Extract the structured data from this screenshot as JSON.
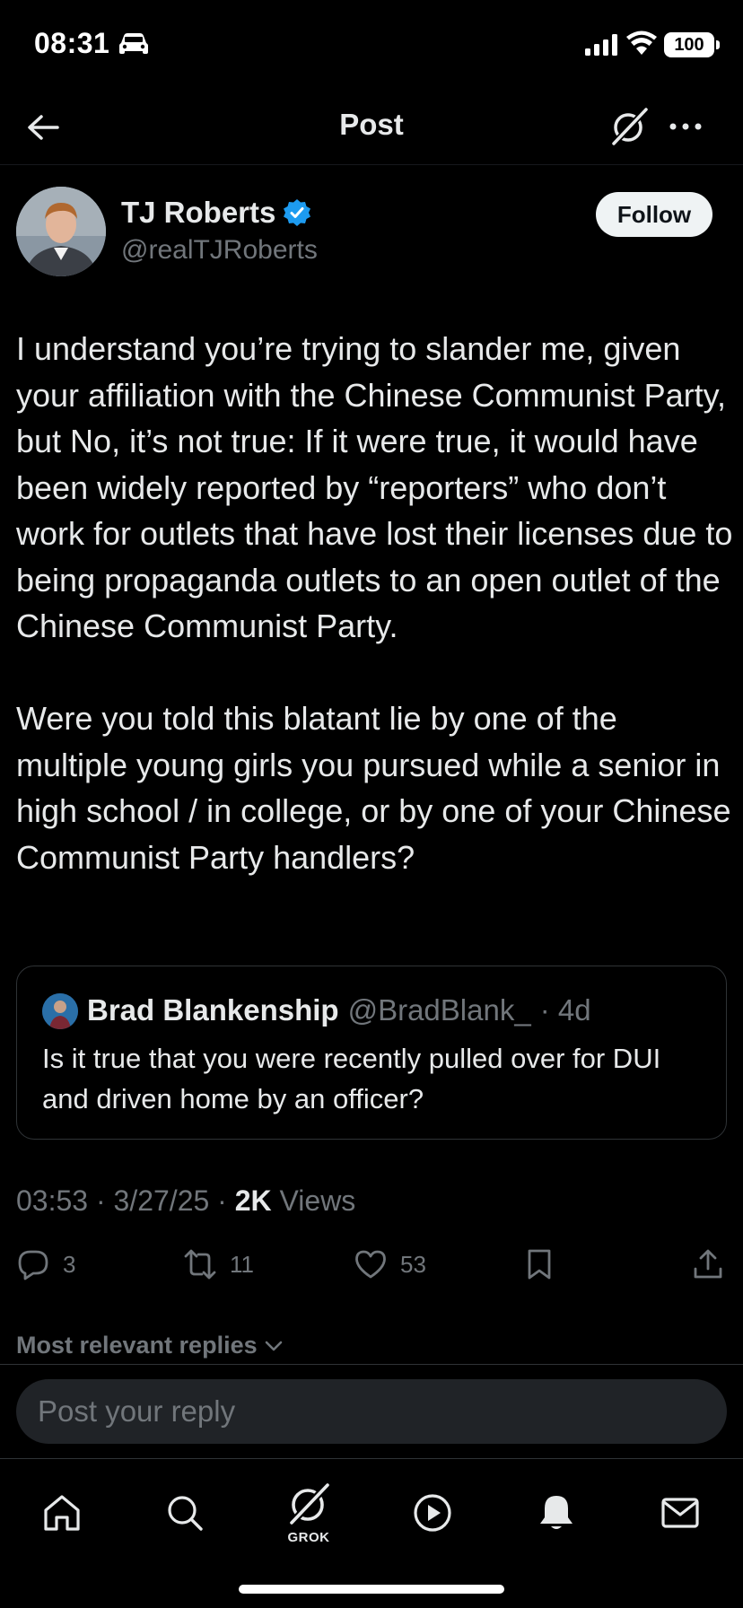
{
  "status_bar": {
    "time": "08:31",
    "battery": "100",
    "icons": [
      "car-icon",
      "signal-icon",
      "wifi-icon",
      "battery-icon"
    ]
  },
  "header": {
    "title": "Post",
    "icons": [
      "back-arrow-icon",
      "grok-icon",
      "more-icon"
    ]
  },
  "author": {
    "name": "TJ Roberts",
    "handle": "@realTJRoberts",
    "verified": true,
    "follow_label": "Follow"
  },
  "post": {
    "paragraphs": [
      "I understand you’re trying to slander me, given your affiliation with the Chinese Communist Party, but No, it’s not true:  If it were true, it would have been widely reported by “reporters” who don’t work for outlets that have lost their licenses due to being propaganda outlets to an open outlet of the Chinese Communist Party.",
      "Were you told this blatant lie by one of the multiple young girls you pursued while a senior in high school / in college, or by one of your Chinese Communist Party handlers?"
    ]
  },
  "quote": {
    "name": "Brad Blankenship",
    "handle": "@BradBlank_",
    "time": "· 4d",
    "text": "Is it true that you were recently pulled over for DUI and driven home by an officer?"
  },
  "meta": {
    "timestamp": "03:53 · 3/27/25 · ",
    "views_count": "2K",
    "views_label": " Views"
  },
  "actions": {
    "replies": "3",
    "reposts": "11",
    "likes": "53"
  },
  "replies_sort": {
    "label": "Most relevant replies"
  },
  "reply_box": {
    "placeholder": "Post your reply"
  },
  "tab_bar": {
    "grok_label": "GROK",
    "tabs": [
      "home-icon",
      "search-icon",
      "grok-icon",
      "video-icon",
      "bell-icon",
      "mail-icon"
    ]
  },
  "colors": {
    "background": "#000000",
    "text": "#e7e9ea",
    "muted": "#71767b",
    "verified": "#1d9bf0",
    "border": "#2f3336"
  }
}
